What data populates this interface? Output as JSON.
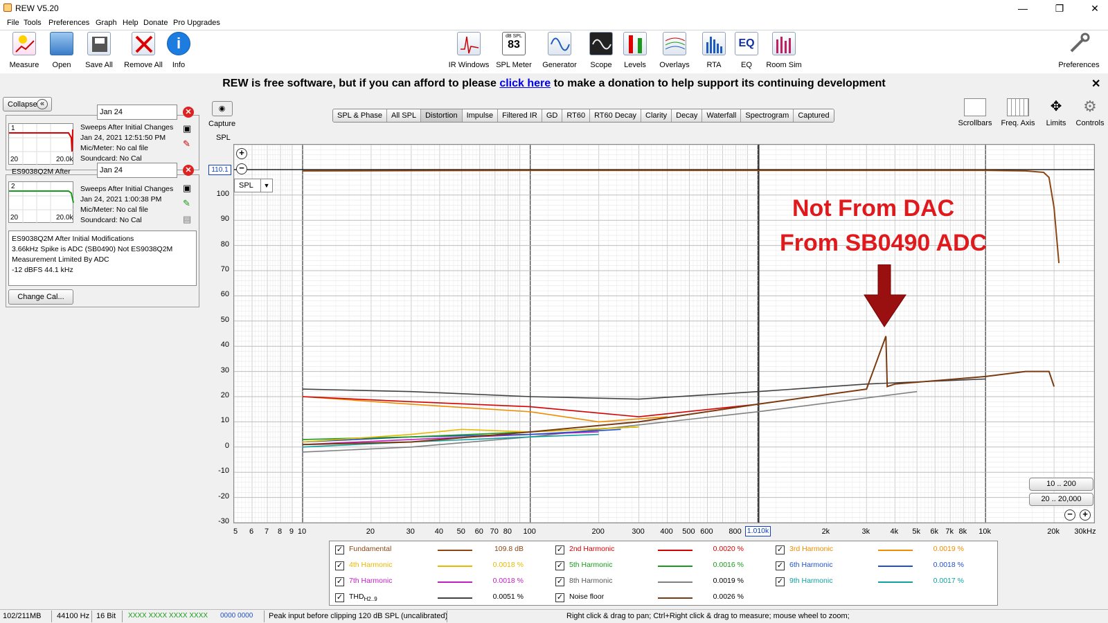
{
  "window": {
    "title": "REW V5.20",
    "minimize": "—",
    "maximize": "❐",
    "close": "✕"
  },
  "menu": [
    "File",
    "Tools",
    "Preferences",
    "Graph",
    "Help",
    "Donate",
    "Pro Upgrades"
  ],
  "toolbar": {
    "left": [
      "Measure",
      "Open",
      "Save All",
      "Remove All",
      "Info"
    ],
    "center": [
      "IR Windows",
      "SPL Meter",
      "Generator",
      "Scope",
      "Levels",
      "Overlays",
      "RTA",
      "EQ",
      "Room Sim"
    ],
    "right": "Preferences",
    "spl_meter_db": "83",
    "spl_meter_unit": "dB SPL",
    "eq_badge": "EQ"
  },
  "banner": {
    "pre": "REW is free software, but if you can afford to please ",
    "link": "click here",
    "post": " to make a donation to help support its continuing development",
    "close": "✕"
  },
  "left": {
    "collapse": "Collapse",
    "collapse_icon": "«",
    "m1": {
      "index": "1",
      "name": "Jan 24",
      "title": "Sweeps After Initial Changes",
      "time": "Jan 24, 2021 12:51:50 PM",
      "mic": "Mic/Meter: No cal file",
      "sound": "Soundcard: No Cal",
      "x0": "20",
      "x1": "20.0k",
      "behind": "ES9038Q2M After"
    },
    "m2": {
      "index": "2",
      "name": "Jan 24",
      "title": "Sweeps After Initial Changes",
      "time": "Jan 24, 2021 1:00:38 PM",
      "mic": "Mic/Meter: No cal file",
      "sound": "Soundcard: No Cal",
      "x0": "20",
      "x1": "20.0k"
    },
    "notes": [
      "ES9038Q2M After Initial Modifications",
      "3.66kHz Spike is ADC (SB0490) Not ES9038Q2M",
      "Measurement Limited By ADC",
      "-12 dBFS 44.1 kHz"
    ],
    "change_cal": "Change Cal..."
  },
  "capture": "Capture",
  "tabs": [
    "SPL & Phase",
    "All SPL",
    "Distortion",
    "Impulse",
    "Filtered IR",
    "GD",
    "RT60",
    "RT60 Decay",
    "Clarity",
    "Decay",
    "Waterfall",
    "Spectrogram",
    "Captured"
  ],
  "selected_tab": "Distortion",
  "right_tools": [
    "Scrollbars",
    "Freq. Axis",
    "Limits",
    "Controls"
  ],
  "graph": {
    "ylabel": "SPL",
    "y_cursor": "110.1",
    "x_cursor": "1.010k",
    "spl_select": "SPL",
    "range_buttons": [
      "10 .. 200",
      "20 .. 20,000"
    ],
    "annotation_line1": "Not From DAC",
    "annotation_line2": "From SB0490 ADC"
  },
  "chart_data": {
    "type": "line",
    "xlabel": "",
    "ylabel": "SPL",
    "x_scale": "log",
    "xlim": [
      5,
      30000
    ],
    "ylim": [
      -30,
      120
    ],
    "grid": true,
    "y_ticks": [
      "100",
      "90",
      "80",
      "70",
      "60",
      "50",
      "40",
      "30",
      "20",
      "10",
      "0",
      "-10",
      "-20",
      "-30"
    ],
    "y_tick_values": [
      100,
      90,
      80,
      70,
      60,
      50,
      40,
      30,
      20,
      10,
      0,
      -10,
      -20,
      -30
    ],
    "x_ticks": [
      "5",
      "6",
      "7",
      "8",
      "9",
      "10",
      "20",
      "30",
      "40",
      "50",
      "60",
      "70",
      "80",
      "100",
      "200",
      "300",
      "400",
      "500",
      "600",
      "800",
      "2k",
      "3k",
      "4k",
      "5k",
      "6k",
      "7k",
      "8k",
      "10k",
      "20k",
      "30kHz"
    ],
    "x_tick_values": [
      5,
      6,
      7,
      8,
      9,
      10,
      20,
      30,
      40,
      50,
      60,
      70,
      80,
      100,
      200,
      300,
      400,
      500,
      600,
      800,
      2000,
      3000,
      4000,
      5000,
      6000,
      7000,
      8000,
      10000,
      20000,
      30000
    ],
    "series": [
      {
        "name": "Fundamental",
        "color": "#8b4513",
        "value": "109.8 dB",
        "x": [
          10,
          100,
          1000,
          10000,
          15000,
          18000,
          19000,
          20000,
          21000
        ],
        "y": [
          109.6,
          109.8,
          109.8,
          109.8,
          109.6,
          109,
          107,
          95,
          73
        ]
      },
      {
        "name": "2nd Harmonic",
        "color": "#d40000",
        "value": "0.0020 %",
        "x": [
          10,
          30,
          100,
          300,
          1000
        ],
        "y": [
          20,
          18,
          16,
          12,
          17
        ]
      },
      {
        "name": "3rd Harmonic",
        "color": "#f08c00",
        "value": "0.0019 %",
        "x": [
          10,
          30,
          100,
          200,
          400
        ],
        "y": [
          20,
          17,
          14,
          10,
          12
        ]
      },
      {
        "name": "4th Harmonic",
        "color": "#e6b800",
        "value": "0.0018 %",
        "x": [
          10,
          30,
          50,
          100,
          300
        ],
        "y": [
          2,
          5,
          7,
          6,
          8
        ]
      },
      {
        "name": "5th Harmonic",
        "color": "#1a9a1a",
        "value": "0.0016 %",
        "x": [
          10,
          30,
          100,
          300
        ],
        "y": [
          3,
          4,
          6,
          8
        ]
      },
      {
        "name": "6th Harmonic",
        "color": "#2050c8",
        "value": "0.0018 %",
        "x": [
          10,
          30,
          100,
          250
        ],
        "y": [
          2,
          4,
          5,
          7
        ]
      },
      {
        "name": "7th Harmonic",
        "color": "#c020c0",
        "value": "0.0018 %",
        "x": [
          10,
          30,
          100,
          200
        ],
        "y": [
          1,
          3,
          5,
          6
        ]
      },
      {
        "name": "8th Harmonic",
        "color": "#808080",
        "value": "0.0019 %",
        "x": [
          10,
          30,
          100,
          1000,
          5000
        ],
        "y": [
          -2,
          0,
          4,
          14,
          22
        ]
      },
      {
        "name": "9th Harmonic",
        "color": "#10a0a0",
        "value": "0.0017 %",
        "x": [
          10,
          30,
          100,
          200
        ],
        "y": [
          0,
          2,
          4,
          5
        ]
      },
      {
        "name": "THD",
        "sub": "H2..9",
        "color": "#404040",
        "value": "0.0051 %",
        "x": [
          10,
          30,
          100,
          300,
          1000,
          3000,
          10000
        ],
        "y": [
          23,
          22,
          20,
          19,
          22,
          25,
          27
        ]
      },
      {
        "name": "Noise floor",
        "color": "#7a3a10",
        "value": "0.0026 %",
        "x": [
          10,
          30,
          100,
          300,
          1000,
          3000,
          3650,
          3700,
          4000,
          10000,
          15000,
          19000,
          20000
        ],
        "y": [
          1,
          2,
          6,
          10,
          17,
          23,
          44,
          24,
          25,
          28,
          30,
          30,
          24
        ]
      }
    ]
  },
  "status": {
    "memory": "102/211MB",
    "rate": "44100 Hz",
    "bits": "16 Bit",
    "meter_green": "XXXX XXXX XXXX XXXX",
    "meter_blue": "0000 0000",
    "peak": "Peak input before clipping 120 dB SPL (uncalibrated)",
    "hint": "Right click & drag to pan; Ctrl+Right click & drag to measure; mouse wheel to zoom;"
  }
}
